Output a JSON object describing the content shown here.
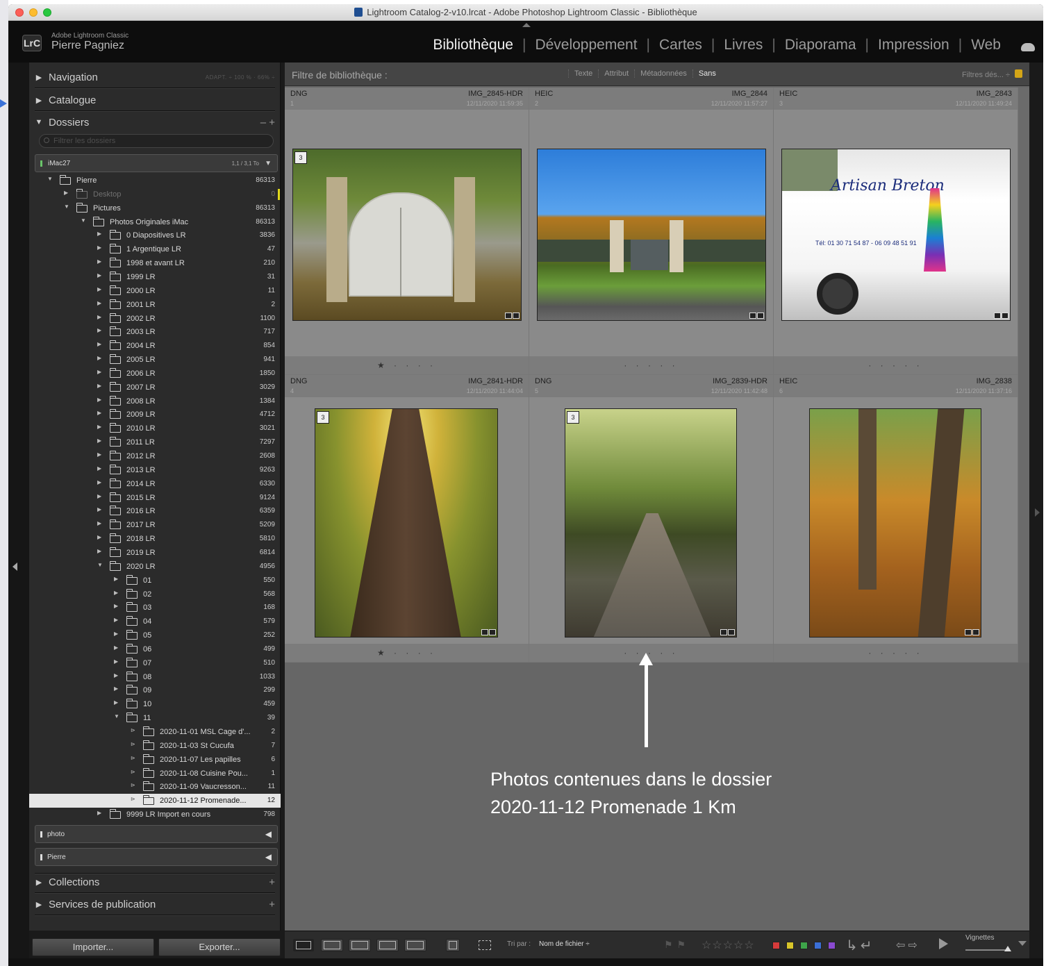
{
  "window": {
    "title": "Lightroom Catalog-2-v10.lrcat - Adobe Photoshop Lightroom Classic - Bibliothèque"
  },
  "identity": {
    "badge": "LrC",
    "app": "Adobe Lightroom Classic",
    "user": "Pierre Pagniez"
  },
  "modules": [
    {
      "label": "Bibliothèque",
      "active": true
    },
    {
      "label": "Développement",
      "active": false
    },
    {
      "label": "Cartes",
      "active": false
    },
    {
      "label": "Livres",
      "active": false
    },
    {
      "label": "Diaporama",
      "active": false
    },
    {
      "label": "Impression",
      "active": false
    },
    {
      "label": "Web",
      "active": false
    }
  ],
  "left_panel": {
    "navigation": {
      "label": "Navigation",
      "options": "ADAPT.  ÷  100 %  ·  66%  ÷"
    },
    "catalogue": {
      "label": "Catalogue"
    },
    "dossiers": {
      "label": "Dossiers",
      "actions": "–  +"
    },
    "folder_filter_placeholder": "Filtrer les dossiers",
    "volume": {
      "name": "iMac27",
      "size": "1,1 / 3,1 To"
    },
    "folders": [
      {
        "label": "Pierre",
        "count": "86313",
        "depth": 0,
        "expanded": true
      },
      {
        "label": "Desktop",
        "count": "0",
        "depth": 1,
        "dim": true
      },
      {
        "label": "Pictures",
        "count": "86313",
        "depth": 1,
        "expanded": true
      },
      {
        "label": "Photos Originales iMac",
        "count": "86313",
        "depth": 2,
        "expanded": true
      },
      {
        "label": "0 Diapositives LR",
        "count": "3836",
        "depth": 3
      },
      {
        "label": "1 Argentique LR",
        "count": "47",
        "depth": 3
      },
      {
        "label": "1998 et avant LR",
        "count": "210",
        "depth": 3
      },
      {
        "label": "1999 LR",
        "count": "31",
        "depth": 3
      },
      {
        "label": "2000 LR",
        "count": "11",
        "depth": 3
      },
      {
        "label": "2001 LR",
        "count": "2",
        "depth": 3
      },
      {
        "label": "2002 LR",
        "count": "1100",
        "depth": 3
      },
      {
        "label": "2003 LR",
        "count": "717",
        "depth": 3
      },
      {
        "label": "2004 LR",
        "count": "854",
        "depth": 3
      },
      {
        "label": "2005 LR",
        "count": "941",
        "depth": 3
      },
      {
        "label": "2006 LR",
        "count": "1850",
        "depth": 3
      },
      {
        "label": "2007 LR",
        "count": "3029",
        "depth": 3
      },
      {
        "label": "2008 LR",
        "count": "1384",
        "depth": 3
      },
      {
        "label": "2009 LR",
        "count": "4712",
        "depth": 3
      },
      {
        "label": "2010 LR",
        "count": "3021",
        "depth": 3
      },
      {
        "label": "2011 LR",
        "count": "7297",
        "depth": 3
      },
      {
        "label": "2012 LR",
        "count": "2608",
        "depth": 3
      },
      {
        "label": "2013 LR",
        "count": "9263",
        "depth": 3
      },
      {
        "label": "2014 LR",
        "count": "6330",
        "depth": 3
      },
      {
        "label": "2015 LR",
        "count": "9124",
        "depth": 3
      },
      {
        "label": "2016 LR",
        "count": "6359",
        "depth": 3
      },
      {
        "label": "2017 LR",
        "count": "5209",
        "depth": 3
      },
      {
        "label": "2018 LR",
        "count": "5810",
        "depth": 3
      },
      {
        "label": "2019 LR",
        "count": "6814",
        "depth": 3
      },
      {
        "label": "2020 LR",
        "count": "4956",
        "depth": 3,
        "expanded": true
      },
      {
        "label": "01",
        "count": "550",
        "depth": 4
      },
      {
        "label": "02",
        "count": "568",
        "depth": 4
      },
      {
        "label": "03",
        "count": "168",
        "depth": 4
      },
      {
        "label": "04",
        "count": "579",
        "depth": 4
      },
      {
        "label": "05",
        "count": "252",
        "depth": 4
      },
      {
        "label": "06",
        "count": "499",
        "depth": 4
      },
      {
        "label": "07",
        "count": "510",
        "depth": 4
      },
      {
        "label": "08",
        "count": "1033",
        "depth": 4
      },
      {
        "label": "09",
        "count": "299",
        "depth": 4
      },
      {
        "label": "10",
        "count": "459",
        "depth": 4
      },
      {
        "label": "11",
        "count": "39",
        "depth": 4,
        "expanded": true
      },
      {
        "label": "2020-11-01 MSL Cage d'...",
        "count": "2",
        "depth": 5,
        "leaf": true
      },
      {
        "label": "2020-11-03 St Cucufa",
        "count": "7",
        "depth": 5,
        "leaf": true
      },
      {
        "label": "2020-11-07 Les papilles",
        "count": "6",
        "depth": 5,
        "leaf": true
      },
      {
        "label": "2020-11-08 Cuisine Pou...",
        "count": "1",
        "depth": 5,
        "leaf": true
      },
      {
        "label": "2020-11-09 Vaucresson...",
        "count": "11",
        "depth": 5,
        "leaf": true
      },
      {
        "label": "2020-11-12 Promenade...",
        "count": "12",
        "depth": 5,
        "leaf": true,
        "selected": true
      },
      {
        "label": "9999 LR Import en cours",
        "count": "798",
        "depth": 3
      }
    ],
    "smart_collections": [
      {
        "name": "photo"
      },
      {
        "name": "Pierre"
      }
    ],
    "collections": {
      "label": "Collections",
      "action": "+"
    },
    "publish": {
      "label": "Services de publication",
      "action": "+"
    },
    "import_label": "Importer...",
    "export_label": "Exporter..."
  },
  "filter_bar": {
    "label": "Filtre de bibliothèque :",
    "options": [
      {
        "label": "Texte",
        "active": false
      },
      {
        "label": "Attribut",
        "active": false
      },
      {
        "label": "Métadonnées",
        "active": false
      },
      {
        "label": "Sans",
        "active": true
      }
    ],
    "presets": "Filtres dés... ÷"
  },
  "grid": {
    "cells": [
      {
        "type": "DNG",
        "name": "IMG_2845-HDR",
        "index": "1",
        "date": "12/11/2020 11:59:35",
        "stack": "3",
        "rating": "★ · · · ·"
      },
      {
        "type": "HEIC",
        "name": "IMG_2844",
        "index": "2",
        "date": "12/11/2020 11:57:27",
        "stack": "",
        "rating": "· · · · ·"
      },
      {
        "type": "HEIC",
        "name": "IMG_2843",
        "index": "3",
        "date": "12/11/2020 11:49:24",
        "stack": "",
        "rating": "· · · · ·",
        "brand": "Artisan Breton",
        "phone": "Tél: 01 30 71 54 87 - 06 09 48 51 91"
      },
      {
        "type": "DNG",
        "name": "IMG_2841-HDR",
        "index": "4",
        "date": "12/11/2020 11:44:04",
        "stack": "3",
        "rating": "★ · · · ·"
      },
      {
        "type": "DNG",
        "name": "IMG_2839-HDR",
        "index": "5",
        "date": "12/11/2020 11:42:48",
        "stack": "3",
        "rating": "· · · · ·"
      },
      {
        "type": "HEIC",
        "name": "IMG_2838",
        "index": "6",
        "date": "12/11/2020 11:37:16",
        "stack": "",
        "rating": "· · · · ·"
      }
    ]
  },
  "annotation": {
    "line1": "Photos contenues dans le dossier",
    "line2": "2020-11-12 Promenade 1 Km"
  },
  "toolbar": {
    "sort_label": "Tri par :",
    "sort_value": "Nom de fichier ÷",
    "thumbnails_label": "Vignettes",
    "thumbnail_size": 0.85,
    "view_icons": [
      "grid-view-icon",
      "loupe-view-icon",
      "compare-view-icon",
      "survey-view-icon",
      "people-view-icon"
    ],
    "label_colors": [
      "#d63b3b",
      "#d8c52a",
      "#3ea44a",
      "#3b6fd6",
      "#8a4ad0"
    ]
  }
}
